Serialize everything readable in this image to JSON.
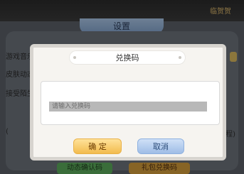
{
  "background": {
    "top_right_text": "临贺贺",
    "settings_title": "设置",
    "left_labels": [
      "游戏音乐",
      "皮肤动态",
      "接受陌生"
    ],
    "right_labels": [
      "(",
      "(程)"
    ],
    "bottom_buttons": [
      "动态确认码",
      "礼包兑换码"
    ]
  },
  "dialog": {
    "title": "兑换码",
    "input_placeholder": "请输入兑换码",
    "input_value": "",
    "confirm_label": "确 定",
    "cancel_label": "取消"
  },
  "colors": {
    "confirm_button": "#f2bb4e",
    "cancel_button": "#9fbde6",
    "dialog_bg": "#f6f4f0"
  }
}
